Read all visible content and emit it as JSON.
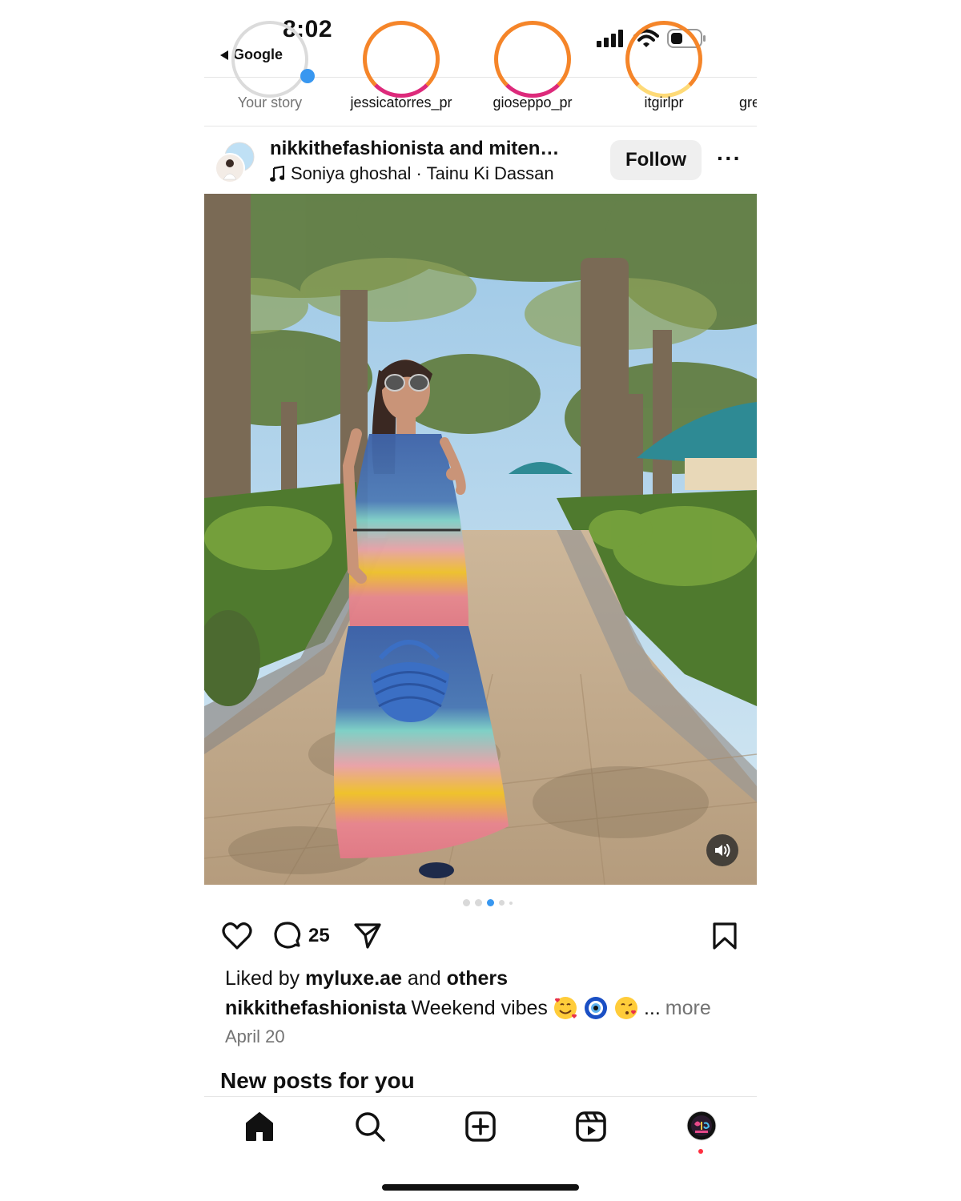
{
  "status_bar": {
    "time": "8:02",
    "back_app": "Google"
  },
  "stories": [
    {
      "name": "Your story",
      "own": true
    },
    {
      "name": "jessicatorres_pr",
      "own": false
    },
    {
      "name": "gioseppo_pr",
      "own": false
    },
    {
      "name": "itgirlpr",
      "own": false
    },
    {
      "name": "gre",
      "own": false
    }
  ],
  "post": {
    "header_user": "nikkithefashionista and miten…",
    "music": "Soniya ghoshal · Tainu Ki Dassan",
    "follow_label": "Follow",
    "more_label": "···",
    "pager": {
      "count": 5,
      "active_index": 2
    },
    "comment_count": "25",
    "liked_prefix": "Liked by ",
    "liked_user": "myluxe.ae",
    "liked_and": " and ",
    "liked_others": "others",
    "caption_user": "nikkithefashionista",
    "caption_text": "Weekend vibes",
    "caption_ellipsis": "...",
    "caption_more": "more",
    "date": "April 20"
  },
  "section_title": "New posts for you",
  "tabbar": {
    "items": [
      "home-icon",
      "search-icon",
      "create-icon",
      "reels-icon",
      "profile-avatar"
    ]
  },
  "colors": {
    "follow_bg": "#efefef",
    "pager_active": "#3897f0",
    "notification": "#ff3040",
    "muted_text": "#737373"
  }
}
